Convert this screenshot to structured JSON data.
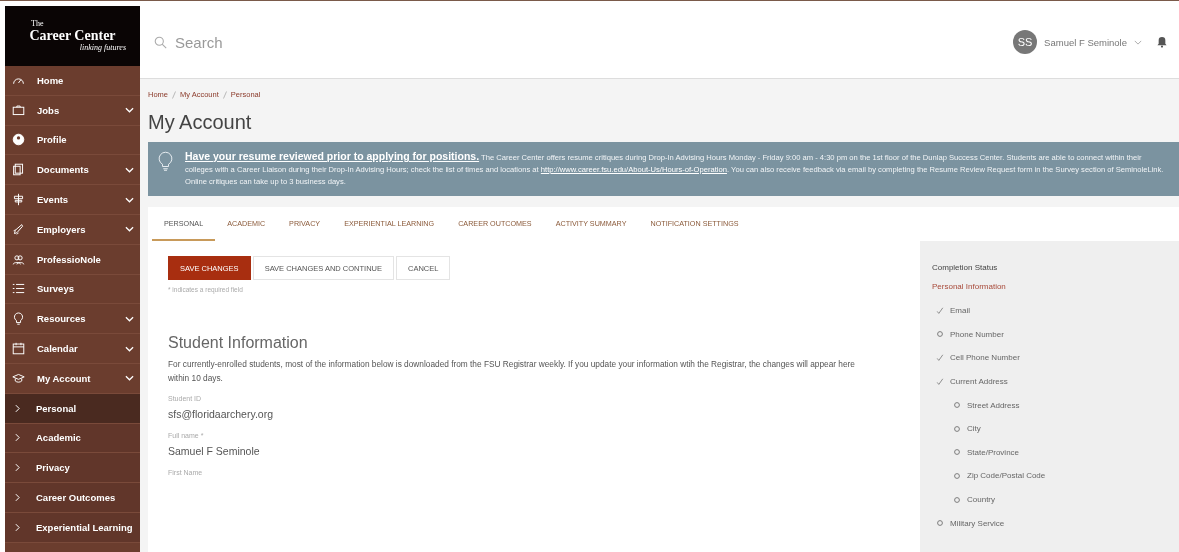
{
  "sidebar": {
    "logo": {
      "small": "The",
      "title": "Career Center",
      "tagline": "linking futures"
    },
    "items": [
      {
        "label": "Home",
        "has_submenu": false
      },
      {
        "label": "Jobs",
        "has_submenu": true
      },
      {
        "label": "Profile",
        "has_submenu": false
      },
      {
        "label": "Documents",
        "has_submenu": true
      },
      {
        "label": "Events",
        "has_submenu": true
      },
      {
        "label": "Employers",
        "has_submenu": true
      },
      {
        "label": "ProfessioNole",
        "has_submenu": false
      },
      {
        "label": "Surveys",
        "has_submenu": false
      },
      {
        "label": "Resources",
        "has_submenu": true
      },
      {
        "label": "Calendar",
        "has_submenu": true
      },
      {
        "label": "My Account",
        "has_submenu": true,
        "children": [
          {
            "label": "Personal",
            "selected": true
          },
          {
            "label": "Academic",
            "selected": false
          },
          {
            "label": "Privacy",
            "selected": false
          },
          {
            "label": "Career Outcomes",
            "selected": false
          },
          {
            "label": "Experiential Learning",
            "selected": false
          }
        ]
      }
    ]
  },
  "topbar": {
    "search": {
      "placeholder": "Search"
    },
    "user": {
      "initials": "SS",
      "name": "Samuel F Seminole"
    }
  },
  "breadcrumb": [
    "Home",
    "My Account",
    "Personal"
  ],
  "page_title": "My Account",
  "alert": {
    "heading": "Have your resume reviewed prior to applying for positions.",
    "text_before_link": "The Career Center offers resume critiques during Drop-In Advising Hours Monday - Friday 9:00 am - 4:30 pm on the 1st floor of the Dunlap Success Center. Students are able to connect within their colleges with a Career Liaison during their Drop-In Advising Hours; check the list of times and locations at",
    "link": "http://www.career.fsu.edu/About-Us/Hours-of-Operation",
    "text_after_link": ". You can also receive feedback via email by completing the Resume Review Request form in the Survey section of SeminoleLink. Online critiques can take up to 3 business days."
  },
  "tabs": [
    {
      "label": "PERSONAL",
      "selected": true
    },
    {
      "label": "ACADEMIC",
      "selected": false
    },
    {
      "label": "PRIVACY",
      "selected": false
    },
    {
      "label": "EXPERIENTIAL LEARNING",
      "selected": false
    },
    {
      "label": "CAREER OUTCOMES",
      "selected": false
    },
    {
      "label": "ACTIVITY SUMMARY",
      "selected": false
    },
    {
      "label": "NOTIFICATION SETTINGS",
      "selected": false
    }
  ],
  "form": {
    "buttons": [
      {
        "label": "SAVE CHANGES",
        "kind": "primary"
      },
      {
        "label": "SAVE CHANGES AND CONTINUE",
        "kind": "default"
      },
      {
        "label": "CANCEL",
        "kind": "default"
      }
    ],
    "required_note": "* indicates a required field",
    "section_title": "Student Information",
    "section_text": "For currently-enrolled students, most of the information below is downloaded from the FSU Registrar weekly. If you update your information wtih the Registrar, the changes will appear here within 10 days.",
    "fields": [
      {
        "label": "Student ID",
        "value": "sfs@floridaarchery.org"
      },
      {
        "label": "Full name *",
        "value": "Samuel F Seminole"
      },
      {
        "label": "First Name"
      }
    ]
  },
  "completion": {
    "title": "Completion Status",
    "section": "Personal Information",
    "items": [
      {
        "label": "Email",
        "done": true
      },
      {
        "label": "Phone Number",
        "done": false
      },
      {
        "label": "Cell Phone Number",
        "done": true
      },
      {
        "label": "Current Address",
        "done": true,
        "children": [
          {
            "label": "Street Address",
            "done": false
          },
          {
            "label": "City",
            "done": false
          },
          {
            "label": "State/Province",
            "done": false
          },
          {
            "label": "Zip Code/Postal Code",
            "done": false
          },
          {
            "label": "Country",
            "done": false
          }
        ]
      },
      {
        "label": "Military Service",
        "done": false
      }
    ]
  }
}
